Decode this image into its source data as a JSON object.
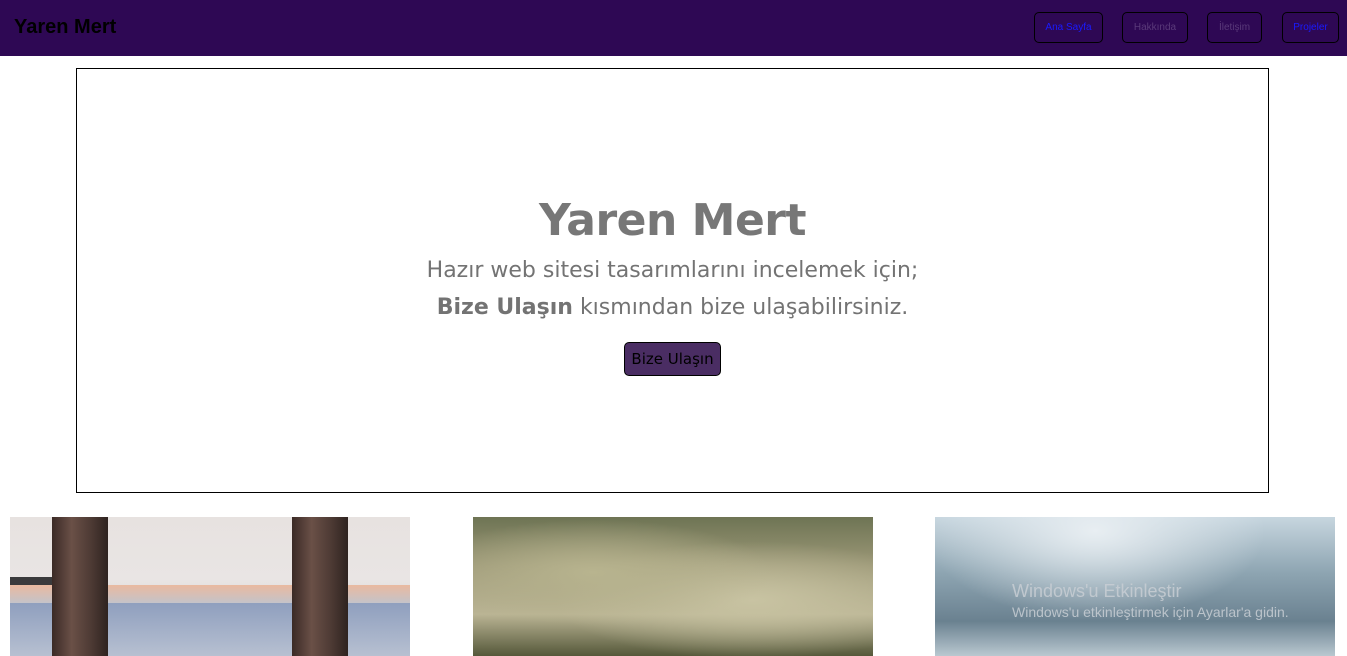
{
  "navbar": {
    "brand": "Yaren Mert",
    "background": "#2e0854",
    "links": [
      {
        "label": "Ana Sayfa",
        "color": "#1a1aff"
      },
      {
        "label": "Hakkında",
        "color": "#5a3a7a"
      },
      {
        "label": "İletişim",
        "color": "#5a3a7a"
      },
      {
        "label": "Projeler",
        "color": "#1a1aff"
      }
    ]
  },
  "hero": {
    "title": "Yaren Mert",
    "line1": "Hazır web sitesi tasarımlarını incelemek için;",
    "line2_bold": "Bize Ulaşın",
    "line2_rest": " kısmından bize ulaşabilirsiniz.",
    "cta_label": "Bize Ulaşın",
    "cta_color": "#4a2d63"
  },
  "gallery": {
    "images": [
      {
        "name": "window-view-photo"
      },
      {
        "name": "fog-landscape-photo"
      },
      {
        "name": "cloudy-sky-photo"
      }
    ]
  },
  "watermark": {
    "title": "Windows'u Etkinleştir",
    "subtitle": "Windows'u etkinleştirmek için Ayarlar'a gidin."
  }
}
